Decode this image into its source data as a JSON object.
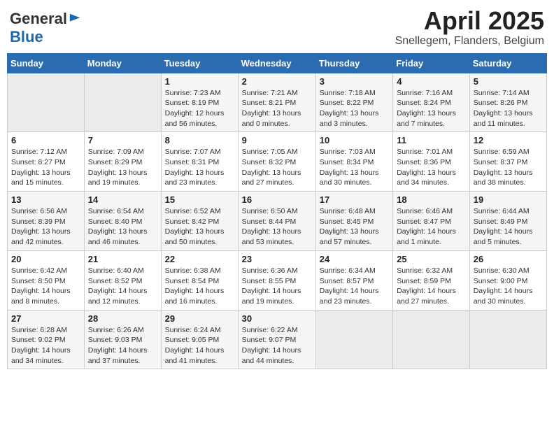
{
  "header": {
    "logo_general": "General",
    "logo_blue": "Blue",
    "month": "April 2025",
    "location": "Snellegem, Flanders, Belgium"
  },
  "columns": [
    "Sunday",
    "Monday",
    "Tuesday",
    "Wednesday",
    "Thursday",
    "Friday",
    "Saturday"
  ],
  "weeks": [
    [
      {
        "day": "",
        "detail": ""
      },
      {
        "day": "",
        "detail": ""
      },
      {
        "day": "1",
        "detail": "Sunrise: 7:23 AM\nSunset: 8:19 PM\nDaylight: 12 hours\nand 56 minutes."
      },
      {
        "day": "2",
        "detail": "Sunrise: 7:21 AM\nSunset: 8:21 PM\nDaylight: 13 hours\nand 0 minutes."
      },
      {
        "day": "3",
        "detail": "Sunrise: 7:18 AM\nSunset: 8:22 PM\nDaylight: 13 hours\nand 3 minutes."
      },
      {
        "day": "4",
        "detail": "Sunrise: 7:16 AM\nSunset: 8:24 PM\nDaylight: 13 hours\nand 7 minutes."
      },
      {
        "day": "5",
        "detail": "Sunrise: 7:14 AM\nSunset: 8:26 PM\nDaylight: 13 hours\nand 11 minutes."
      }
    ],
    [
      {
        "day": "6",
        "detail": "Sunrise: 7:12 AM\nSunset: 8:27 PM\nDaylight: 13 hours\nand 15 minutes."
      },
      {
        "day": "7",
        "detail": "Sunrise: 7:09 AM\nSunset: 8:29 PM\nDaylight: 13 hours\nand 19 minutes."
      },
      {
        "day": "8",
        "detail": "Sunrise: 7:07 AM\nSunset: 8:31 PM\nDaylight: 13 hours\nand 23 minutes."
      },
      {
        "day": "9",
        "detail": "Sunrise: 7:05 AM\nSunset: 8:32 PM\nDaylight: 13 hours\nand 27 minutes."
      },
      {
        "day": "10",
        "detail": "Sunrise: 7:03 AM\nSunset: 8:34 PM\nDaylight: 13 hours\nand 30 minutes."
      },
      {
        "day": "11",
        "detail": "Sunrise: 7:01 AM\nSunset: 8:36 PM\nDaylight: 13 hours\nand 34 minutes."
      },
      {
        "day": "12",
        "detail": "Sunrise: 6:59 AM\nSunset: 8:37 PM\nDaylight: 13 hours\nand 38 minutes."
      }
    ],
    [
      {
        "day": "13",
        "detail": "Sunrise: 6:56 AM\nSunset: 8:39 PM\nDaylight: 13 hours\nand 42 minutes."
      },
      {
        "day": "14",
        "detail": "Sunrise: 6:54 AM\nSunset: 8:40 PM\nDaylight: 13 hours\nand 46 minutes."
      },
      {
        "day": "15",
        "detail": "Sunrise: 6:52 AM\nSunset: 8:42 PM\nDaylight: 13 hours\nand 50 minutes."
      },
      {
        "day": "16",
        "detail": "Sunrise: 6:50 AM\nSunset: 8:44 PM\nDaylight: 13 hours\nand 53 minutes."
      },
      {
        "day": "17",
        "detail": "Sunrise: 6:48 AM\nSunset: 8:45 PM\nDaylight: 13 hours\nand 57 minutes."
      },
      {
        "day": "18",
        "detail": "Sunrise: 6:46 AM\nSunset: 8:47 PM\nDaylight: 14 hours\nand 1 minute."
      },
      {
        "day": "19",
        "detail": "Sunrise: 6:44 AM\nSunset: 8:49 PM\nDaylight: 14 hours\nand 5 minutes."
      }
    ],
    [
      {
        "day": "20",
        "detail": "Sunrise: 6:42 AM\nSunset: 8:50 PM\nDaylight: 14 hours\nand 8 minutes."
      },
      {
        "day": "21",
        "detail": "Sunrise: 6:40 AM\nSunset: 8:52 PM\nDaylight: 14 hours\nand 12 minutes."
      },
      {
        "day": "22",
        "detail": "Sunrise: 6:38 AM\nSunset: 8:54 PM\nDaylight: 14 hours\nand 16 minutes."
      },
      {
        "day": "23",
        "detail": "Sunrise: 6:36 AM\nSunset: 8:55 PM\nDaylight: 14 hours\nand 19 minutes."
      },
      {
        "day": "24",
        "detail": "Sunrise: 6:34 AM\nSunset: 8:57 PM\nDaylight: 14 hours\nand 23 minutes."
      },
      {
        "day": "25",
        "detail": "Sunrise: 6:32 AM\nSunset: 8:59 PM\nDaylight: 14 hours\nand 27 minutes."
      },
      {
        "day": "26",
        "detail": "Sunrise: 6:30 AM\nSunset: 9:00 PM\nDaylight: 14 hours\nand 30 minutes."
      }
    ],
    [
      {
        "day": "27",
        "detail": "Sunrise: 6:28 AM\nSunset: 9:02 PM\nDaylight: 14 hours\nand 34 minutes."
      },
      {
        "day": "28",
        "detail": "Sunrise: 6:26 AM\nSunset: 9:03 PM\nDaylight: 14 hours\nand 37 minutes."
      },
      {
        "day": "29",
        "detail": "Sunrise: 6:24 AM\nSunset: 9:05 PM\nDaylight: 14 hours\nand 41 minutes."
      },
      {
        "day": "30",
        "detail": "Sunrise: 6:22 AM\nSunset: 9:07 PM\nDaylight: 14 hours\nand 44 minutes."
      },
      {
        "day": "",
        "detail": ""
      },
      {
        "day": "",
        "detail": ""
      },
      {
        "day": "",
        "detail": ""
      }
    ]
  ]
}
